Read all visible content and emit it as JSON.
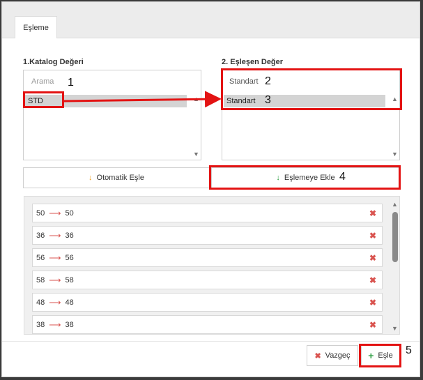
{
  "tab": {
    "label": "Eşleme"
  },
  "left": {
    "label": "1.Katalog Değeri",
    "search_placeholder": "Arama",
    "items": [
      "STD"
    ]
  },
  "right": {
    "label": "2. Eşleşen Değer",
    "search_value": "Standart",
    "items": [
      "Standart"
    ]
  },
  "buttons": {
    "auto_match": "Otomatik Eşle",
    "add_mapping": "Eşlemeye Ekle",
    "cancel": "Vazgeç",
    "match": "Eşle"
  },
  "mappings": [
    {
      "from": "50",
      "to": "50"
    },
    {
      "from": "36",
      "to": "36"
    },
    {
      "from": "56",
      "to": "56"
    },
    {
      "from": "58",
      "to": "58"
    },
    {
      "from": "48",
      "to": "48"
    },
    {
      "from": "38",
      "to": "38"
    }
  ],
  "annotations": [
    "1",
    "2",
    "3",
    "4",
    "5"
  ],
  "colors": {
    "accent_green": "#2e9e44",
    "accent_orange": "#f0a020",
    "delete_red": "#d9534f",
    "annotation_red": "#e31313"
  }
}
